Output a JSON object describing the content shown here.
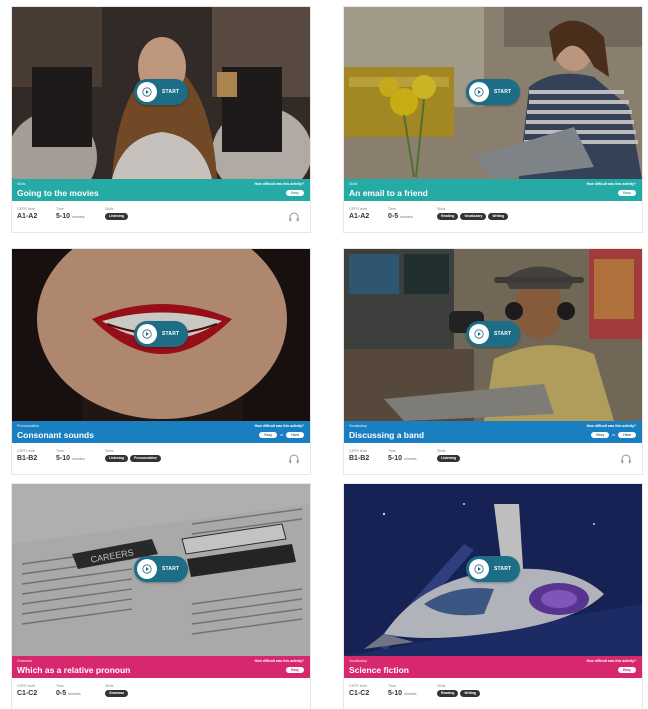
{
  "cards": [
    {
      "category": "Skills",
      "title": "Going to the movies",
      "band_color": "#26aaa6",
      "question": "How difficult was this activity?",
      "chips": [
        "Easy"
      ],
      "chip_join": "",
      "level_label": "CEFR level",
      "level": "A1-A2",
      "time_label": "Time",
      "time": "5-10",
      "time_unit": "minutes",
      "skills_label": "Skills",
      "skills": [
        "Listening"
      ],
      "has_audio_icon": true
    },
    {
      "category": "Skills",
      "title": "An email to a friend",
      "band_color": "#26aaa6",
      "question": "How difficult was this activity?",
      "chips": [
        "Easy"
      ],
      "chip_join": "",
      "level_label": "CEFR level",
      "level": "A1-A2",
      "time_label": "Time",
      "time": "0-5",
      "time_unit": "minutes",
      "skills_label": "Skills",
      "skills": [
        "Reading",
        "Vocabulary",
        "Writing"
      ],
      "has_audio_icon": false
    },
    {
      "category": "Pronunciation",
      "title": "Consonant sounds",
      "band_color": "#1a7fc1",
      "question": "How difficult was this activity?",
      "chips": [
        "Easy",
        "Hard"
      ],
      "chip_join": "or",
      "level_label": "CEFR level",
      "level": "B1-B2",
      "time_label": "Time",
      "time": "5-10",
      "time_unit": "minutes",
      "skills_label": "Skills",
      "skills": [
        "Listening",
        "Pronunciation"
      ],
      "has_audio_icon": true
    },
    {
      "category": "Vocabulary",
      "title": "Discussing a band",
      "band_color": "#1a7fc1",
      "question": "How difficult was this activity?",
      "chips": [
        "Easy",
        "Hard"
      ],
      "chip_join": "or",
      "level_label": "CEFR level",
      "level": "B1-B2",
      "time_label": "Time",
      "time": "5-10",
      "time_unit": "minutes",
      "skills_label": "Skills",
      "skills": [
        "Listening"
      ],
      "has_audio_icon": true
    },
    {
      "category": "Grammar",
      "title": "Which as a relative pronoun",
      "band_color": "#d7276f",
      "question": "How difficult was this activity?",
      "chips": [
        "Easy"
      ],
      "chip_join": "",
      "level_label": "CEFR level",
      "level": "C1-C2",
      "time_label": "Time",
      "time": "0-5",
      "time_unit": "minutes",
      "skills_label": "Skills",
      "skills": [
        "Grammar"
      ],
      "has_audio_icon": false
    },
    {
      "category": "Vocabulary",
      "title": "Science fiction",
      "band_color": "#d7276f",
      "question": "How difficult was this activity?",
      "chips": [
        "Easy"
      ],
      "chip_join": "",
      "level_label": "CEFR level",
      "level": "C1-C2",
      "time_label": "Time",
      "time": "5-10",
      "time_unit": "minutes",
      "skills_label": "Skills",
      "skills": [
        "Reading",
        "Writing"
      ],
      "has_audio_icon": false
    }
  ],
  "start_label": "START",
  "icons": {
    "start": "play-icon",
    "audio": "headphones-icon"
  }
}
